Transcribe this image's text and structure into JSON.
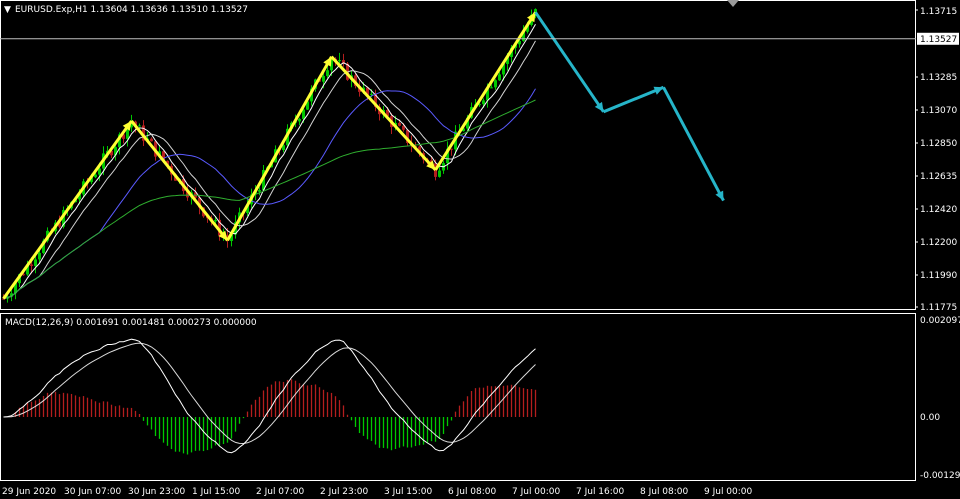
{
  "main_panel": {
    "title": "EURUSD.Exp,H1  1.13604 1.13636 1.13510 1.13527",
    "price_ticks": [
      "1.13715",
      "1.13285",
      "1.13070",
      "1.12850",
      "1.12635",
      "1.12420",
      "1.12200",
      "1.11990",
      "1.11775"
    ],
    "current_price_label": "1.13527",
    "current_price": 1.13527
  },
  "macd_panel": {
    "title": "MACD(12,26,9) 0.001691 0.001481 0.000273 0.000000",
    "ticks": [
      "0.002097",
      "0.00",
      "-0.001296"
    ]
  },
  "time_axis": {
    "labels": [
      "29 Jun 2020",
      "30 Jun 07:00",
      "30 Jun 23:00",
      "1 Jul 15:00",
      "2 Jul 07:00",
      "2 Jul 23:00",
      "3 Jul 15:00",
      "6 Jul 08:00",
      "7 Jul 00:00",
      "7 Jul 16:00",
      "8 Jul 08:00",
      "9 Jul 00:00"
    ]
  },
  "colors": {
    "background": "#000000",
    "bull_candle": "#00c800",
    "bear_candle": "#b41e1e",
    "zigzag": "#ffff33",
    "forecast": "#26b5c9",
    "ma_fast": "#ffffff",
    "ma_mid": "#d2d2d2",
    "ma_slow": "#5a5aff",
    "ma_long": "#2fae2f",
    "macd_line": "#ffffff",
    "signal_line": "#ffffff",
    "grid": "#ffffff"
  },
  "chart_data": [
    {
      "type": "candlestick",
      "symbol": "EURUSD.Exp",
      "timeframe": "H1",
      "ylim": [
        1.1173,
        1.1383
      ],
      "zigzag": [
        {
          "bar": 0,
          "price": 1.1183
        },
        {
          "bar": 32,
          "price": 1.1299
        },
        {
          "bar": 56,
          "price": 1.1221
        },
        {
          "bar": 82,
          "price": 1.1341
        },
        {
          "bar": 108,
          "price": 1.1267
        },
        {
          "bar": 133,
          "price": 1.137
        }
      ],
      "forecast": [
        {
          "bar": 133,
          "price": 1.137
        },
        {
          "bar": 150,
          "price": 1.1305
        },
        {
          "bar": 165,
          "price": 1.1321
        },
        {
          "bar": 180,
          "price": 1.1247
        }
      ],
      "moving_average_colors": [
        "ma_fast",
        "ma_mid",
        "ma_slow",
        "ma_long"
      ]
    },
    {
      "type": "macd",
      "params": [
        12,
        26,
        9
      ],
      "values": {
        "macd": 0.001691,
        "signal": 0.001481,
        "osma": 0.000273,
        "level": 0.0
      },
      "ylim": [
        -0.001296,
        0.002097
      ]
    }
  ]
}
